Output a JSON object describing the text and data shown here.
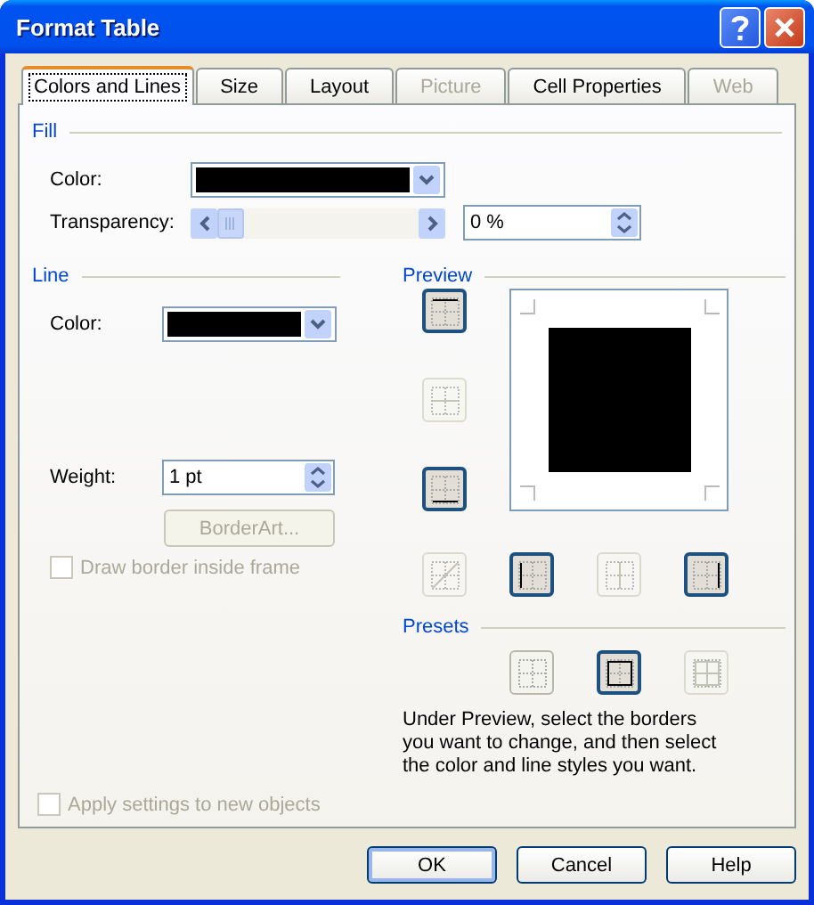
{
  "window": {
    "title": "Format Table"
  },
  "tabs": [
    {
      "label": "Colors and Lines",
      "selected": true,
      "disabled": false
    },
    {
      "label": "Size",
      "selected": false,
      "disabled": false
    },
    {
      "label": "Layout",
      "selected": false,
      "disabled": false
    },
    {
      "label": "Picture",
      "selected": false,
      "disabled": true
    },
    {
      "label": "Cell Properties",
      "selected": false,
      "disabled": false
    },
    {
      "label": "Web",
      "selected": false,
      "disabled": true
    }
  ],
  "fill": {
    "heading": "Fill",
    "color": {
      "label": "Color:",
      "color": "#000000"
    },
    "transparency": {
      "label": "Transparency:",
      "value": "0 %"
    }
  },
  "line": {
    "heading": "Line",
    "color": {
      "label": "Color:",
      "color": "#000000"
    },
    "weight": {
      "label": "Weight:",
      "value": "1 pt"
    },
    "border_art": {
      "label": "BorderArt...",
      "disabled": true
    },
    "draw_inside": {
      "label": "Draw border inside frame",
      "checked": false,
      "disabled": true
    }
  },
  "preview": {
    "heading": "Preview",
    "color": "#000000",
    "border_buttons": [
      {
        "kind": "top",
        "selected": true,
        "disabled": false
      },
      {
        "kind": "middle_h",
        "selected": false,
        "disabled": true
      },
      {
        "kind": "bottom",
        "selected": true,
        "disabled": false
      },
      {
        "kind": "diagonal",
        "selected": false,
        "disabled": true
      },
      {
        "kind": "left",
        "selected": true,
        "disabled": false
      },
      {
        "kind": "middle_v",
        "selected": false,
        "disabled": true
      },
      {
        "kind": "right",
        "selected": true,
        "disabled": false
      }
    ]
  },
  "presets": {
    "heading": "Presets",
    "items": [
      {
        "kind": "none",
        "selected": false,
        "disabled": false
      },
      {
        "kind": "box",
        "selected": true,
        "disabled": false
      },
      {
        "kind": "grid",
        "selected": false,
        "disabled": true
      }
    ]
  },
  "hint": "Under Preview, select the borders you want to change, and then select the color and line styles you want.",
  "apply_settings": {
    "label": "Apply settings to new objects",
    "checked": false,
    "disabled": true
  },
  "buttons": [
    {
      "label": "OK",
      "default": true
    },
    {
      "label": "Cancel",
      "default": false
    },
    {
      "label": "Help",
      "default": false
    }
  ]
}
